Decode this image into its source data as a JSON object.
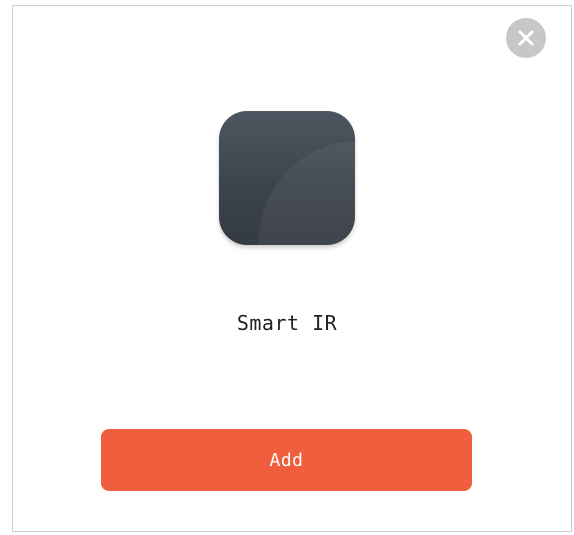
{
  "dialog": {
    "close_icon": "close-icon",
    "device_icon": "smart-ir-device-icon",
    "device_name": "Smart IR",
    "add_label": "Add",
    "colors": {
      "accent": "#f05e3d",
      "close_bg": "#c7c7c9",
      "icon_bg": "#434a53",
      "text": "#222222"
    }
  }
}
